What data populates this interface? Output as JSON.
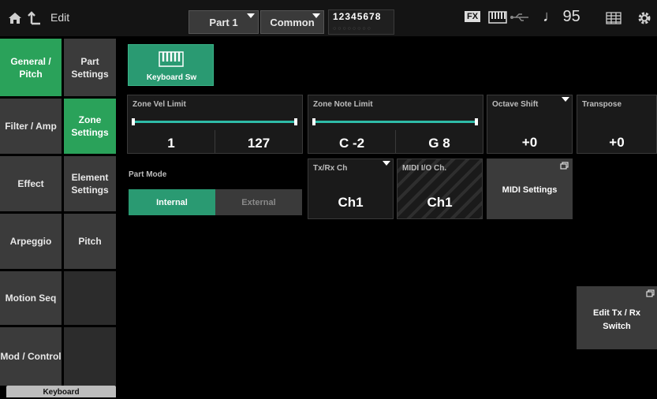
{
  "topbar": {
    "edit_label": "Edit",
    "part_label": "Part 1",
    "common_label": "Common",
    "part_numbers": "12345678",
    "fx_label": "FX",
    "tempo": "♩ 95"
  },
  "nav_primary": [
    {
      "label": "General / Pitch",
      "active": true
    },
    {
      "label": "Filter / Amp"
    },
    {
      "label": "Effect"
    },
    {
      "label": "Arpeggio"
    },
    {
      "label": "Motion Seq"
    },
    {
      "label": "Mod / Control"
    }
  ],
  "nav_secondary": [
    {
      "label": "Part Settings"
    },
    {
      "label": "Zone Settings",
      "active": true
    },
    {
      "label": "Element Settings"
    },
    {
      "label": "Pitch"
    }
  ],
  "keyboard_sw": {
    "label": "Keyboard Sw",
    "on": true
  },
  "zone_vel_limit": {
    "label": "Zone Vel Limit",
    "low": "1",
    "high": "127"
  },
  "zone_note_limit": {
    "label": "Zone Note Limit",
    "low": "C -2",
    "high": "G 8"
  },
  "octave_shift": {
    "label": "Octave Shift",
    "value": "+0"
  },
  "transpose": {
    "label": "Transpose",
    "value": "+0"
  },
  "part_mode": {
    "label": "Part Mode",
    "options": [
      "Internal",
      "External"
    ],
    "selected": "Internal"
  },
  "tx_rx_ch": {
    "label": "Tx/Rx Ch",
    "value": "Ch1"
  },
  "midi_io_ch": {
    "label": "MIDI I/O Ch.",
    "value": "Ch1"
  },
  "midi_settings": {
    "label": "MIDI Settings"
  },
  "edit_txrx": {
    "label": "Edit Tx / Rx Switch"
  },
  "bottom_tab": {
    "label": "Keyboard"
  },
  "colors": {
    "accent": "#2aa25a",
    "bar": "#2fbca8",
    "background": "#000000"
  }
}
